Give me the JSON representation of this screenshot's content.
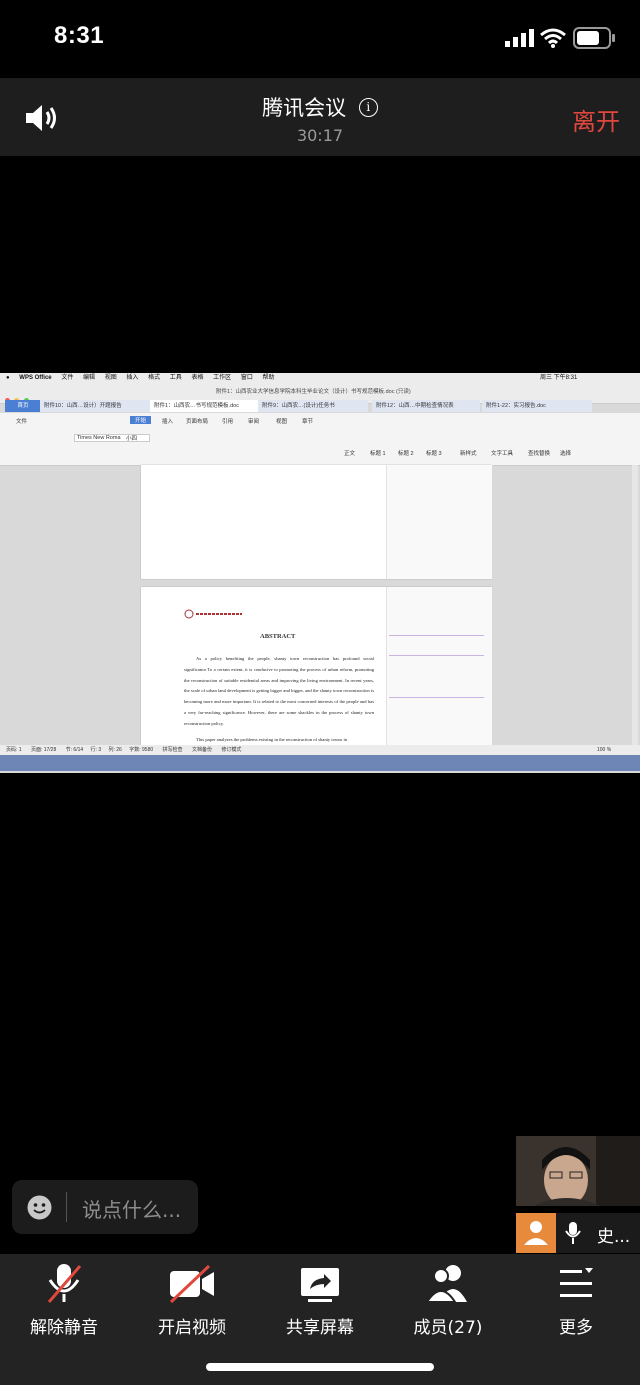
{
  "status_bar": {
    "time": "8:31"
  },
  "header": {
    "title": "腾讯会议",
    "timer": "30:17",
    "leave_label": "离开"
  },
  "shared_screen": {
    "window_title": "附件1：山西农业大学信息学院本科生毕业论文（设计）书写规范模板.doc (只读)",
    "menu": [
      "WPS Office",
      "文件",
      "编辑",
      "视图",
      "插入",
      "格式",
      "工具",
      "表格",
      "工作区",
      "窗口",
      "帮助"
    ],
    "clock": "周三 下午8:31",
    "tabs": [
      "首页",
      "附件10：山西…设计）开题报告",
      "附件1：山西农…书写规范模板.doc",
      "附件9：山西农…(设计)任务书",
      "附件12：山西…中期检查情况表",
      "附件1-22：实习报告.doc"
    ],
    "ribbon_tabs": [
      "文件",
      "开始",
      "插入",
      "页面布局",
      "引用",
      "审阅",
      "视图",
      "章节"
    ],
    "font_name": "Times New Roma",
    "font_size": "小四",
    "styles": [
      "正文",
      "标题 1",
      "标题 2",
      "标题 3",
      "新样式"
    ],
    "tools": [
      "文字工具",
      "查找替换",
      "选择"
    ],
    "doc_heading": "ABSTRACT",
    "doc_body": "As a policy benefiting the people, shanty town reconstruction has profound social significance.To a certain extent, it is conducive to promoting the process of urban reform, promoting the reconstruction of suitable residential areas and improving the living environment. In recent years, the scale of urban land development is getting bigger and bigger, and the shanty town reconstruction is becoming more and more important. It is related to the most concerned interests of the people and has a very far-reaching significance. However, there are some shackles in the process of shanty town reconstruction policy.",
    "doc_body_2": "This paper analyzes the problems existing in the reconstruction of shanty towns in",
    "status_items": [
      "页码: 1",
      "页面: 17/28",
      "节: 6/14",
      "行: 3",
      "列: 26",
      "字数: 9580",
      "拼写检查",
      "文档备份",
      "修订模式"
    ],
    "zoom": "100 %"
  },
  "chat": {
    "placeholder": "说点什么..."
  },
  "participant": {
    "name": "史..."
  },
  "controls": [
    {
      "label": "解除静音",
      "icon": "mic-muted-icon"
    },
    {
      "label": "开启视频",
      "icon": "video-off-icon"
    },
    {
      "label": "共享屏幕",
      "icon": "share-screen-icon"
    },
    {
      "label": "成员(27)",
      "icon": "members-icon"
    },
    {
      "label": "更多",
      "icon": "more-menu-icon"
    }
  ]
}
